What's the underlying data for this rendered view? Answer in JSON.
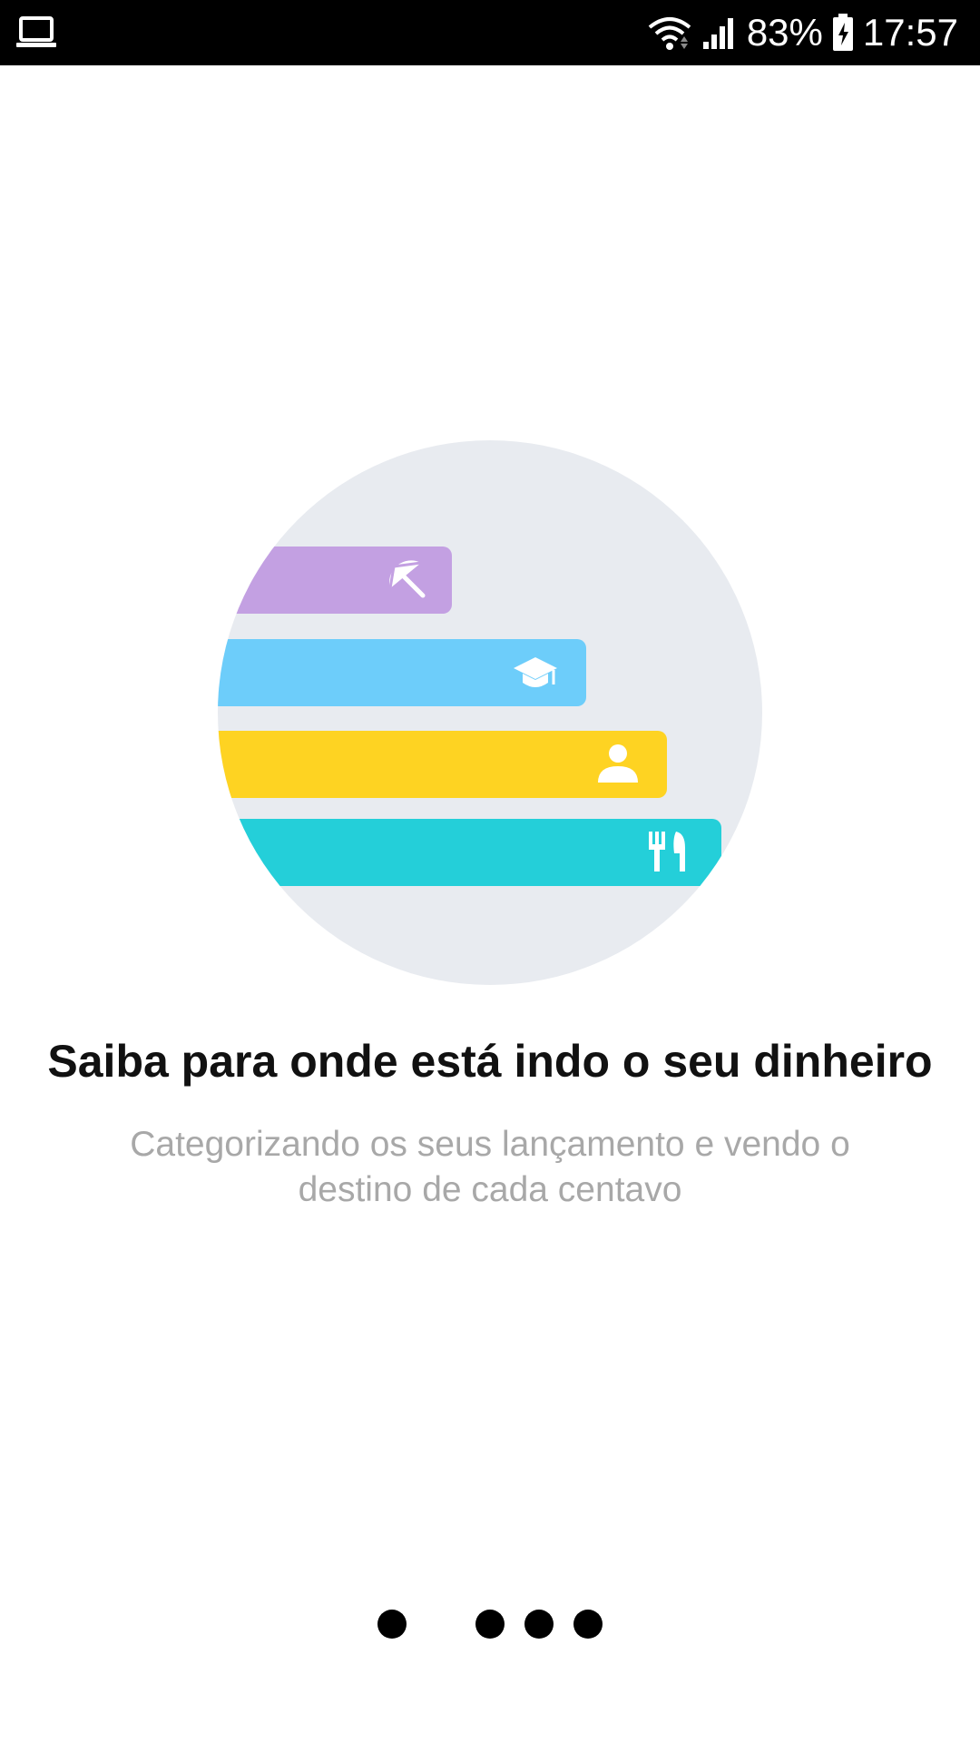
{
  "status_bar": {
    "battery": "83%",
    "time": "17:57",
    "icons": [
      "laptop-icon",
      "wifi-icon",
      "signal-icon",
      "battery-charging-icon"
    ]
  },
  "onboarding": {
    "title": "Saiba para onde está indo o seu dinheiro",
    "description": "Categorizando os seus lançamento e vendo o destino de cada centavo",
    "illustration": {
      "circle_color": "#e8ebf0",
      "bars": [
        {
          "icon": "beach-umbrella-icon",
          "color": "#c3a0e2"
        },
        {
          "icon": "graduation-cap-icon",
          "color": "#6dcdfa"
        },
        {
          "icon": "person-icon",
          "color": "#fed322"
        },
        {
          "icon": "fork-knife-icon",
          "color": "#24cfd9"
        }
      ]
    }
  },
  "pager": {
    "page_count": 4,
    "active_index": 0
  }
}
